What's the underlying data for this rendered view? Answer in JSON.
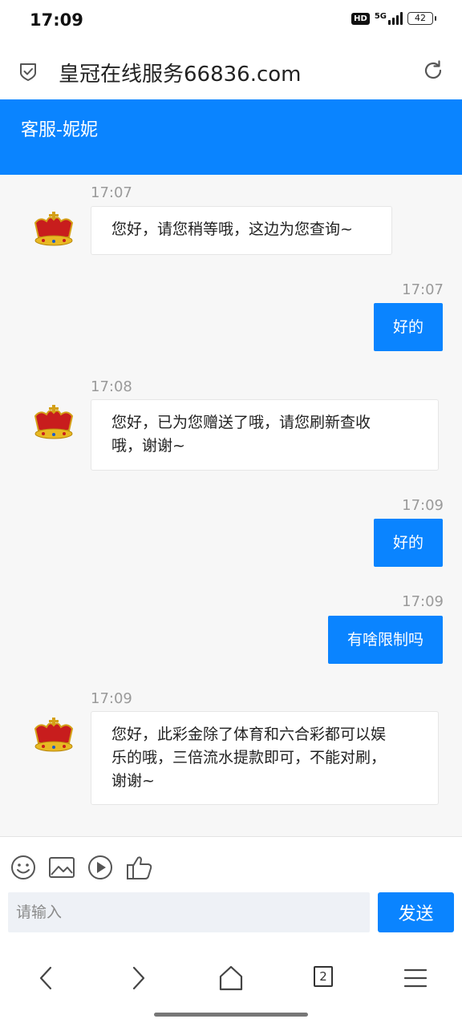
{
  "status": {
    "time": "17:09",
    "hd": "HD",
    "network": "5G",
    "battery": "42"
  },
  "browser": {
    "page_title": "皇冠在线服务66836.com",
    "tab_count": "2"
  },
  "chat": {
    "title": "客服-妮妮",
    "messages": [
      {
        "from": "agent",
        "time": "17:07",
        "text": "您好，请您稍等哦，这边为您查询~"
      },
      {
        "from": "user",
        "time": "17:07",
        "text": "好的"
      },
      {
        "from": "agent",
        "time": "17:08",
        "lines": [
          "您好，已为您赠送了哦，请您刷新查收",
          "哦，谢谢~"
        ]
      },
      {
        "from": "user",
        "time": "17:09",
        "text": "好的"
      },
      {
        "from": "user",
        "time": "17:09",
        "text": "有啥限制吗"
      },
      {
        "from": "agent",
        "time": "17:09",
        "lines": [
          "您好，此彩金除了体育和六合彩都可以娱",
          "乐的哦，三倍流水提款即可，不能对刷，",
          "谢谢~"
        ]
      }
    ]
  },
  "composer": {
    "placeholder": "请输入",
    "send_label": "发送",
    "tools": [
      "emoji-icon",
      "image-icon",
      "video-icon",
      "thumbs-up-icon"
    ]
  },
  "colors": {
    "accent": "#0a84ff",
    "chat_background": "#f7f7f7"
  }
}
